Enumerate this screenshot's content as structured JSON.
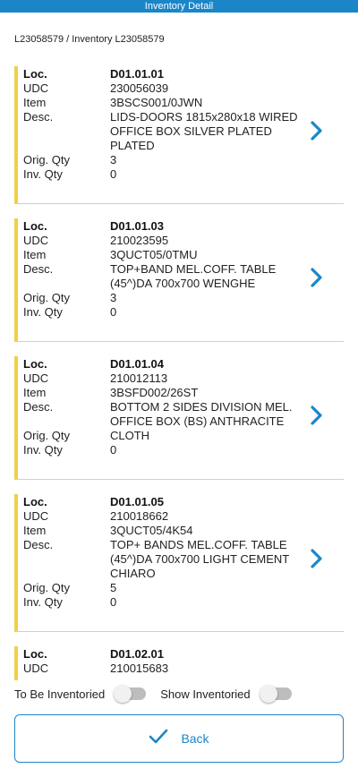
{
  "header": {
    "title": "Inventory Detail"
  },
  "breadcrumb": "L23058579 / Inventory L23058579",
  "labels": {
    "loc": "Loc.",
    "udc": "UDC",
    "item": "Item",
    "desc": "Desc.",
    "orig_qty": "Orig. Qty",
    "inv_qty": "Inv. Qty"
  },
  "items": [
    {
      "loc": "D01.01.01",
      "udc": "230056039",
      "item": "3BSCS001/0JWN",
      "desc": "LIDS-DOORS 1815x280x18 WIRED OFFICE BOX  SILVER PLATED PLATED",
      "orig_qty": "3",
      "inv_qty": "0"
    },
    {
      "loc": "D01.01.03",
      "udc": "210023595",
      "item": "3QUCT05/0TMU",
      "desc": "TOP+BAND MEL.COFF. TABLE (45^)DA 700x700 WENGHE",
      "orig_qty": "3",
      "inv_qty": "0"
    },
    {
      "loc": "D01.01.04",
      "udc": "210012113",
      "item": "3BSFD002/26ST",
      "desc": "BOTTOM 2 SIDES DIVISION MEL. OFFICE BOX (BS) ANTHRACITE",
      "orig_qty": "CLOTH",
      "inv_qty": "0"
    },
    {
      "loc": "D01.01.05",
      "udc": "210018662",
      "item": "3QUCT05/4K54",
      "desc": "TOP+ BANDS MEL.COFF. TABLE (45^)DA 700x700 LIGHT CEMENT CHIARO",
      "orig_qty": "5",
      "inv_qty": "0"
    },
    {
      "loc": "D01.02.01",
      "udc": "210015683"
    }
  ],
  "filters": {
    "to_be_inventoried": {
      "label": "To Be Inventoried",
      "on": false
    },
    "show_inventoried": {
      "label": "Show Inventoried",
      "on": false
    }
  },
  "footer": {
    "back_label": "Back"
  },
  "colors": {
    "accent": "#1a86c8",
    "marker": "#f2cf44",
    "divider": "#cfcfcf"
  }
}
